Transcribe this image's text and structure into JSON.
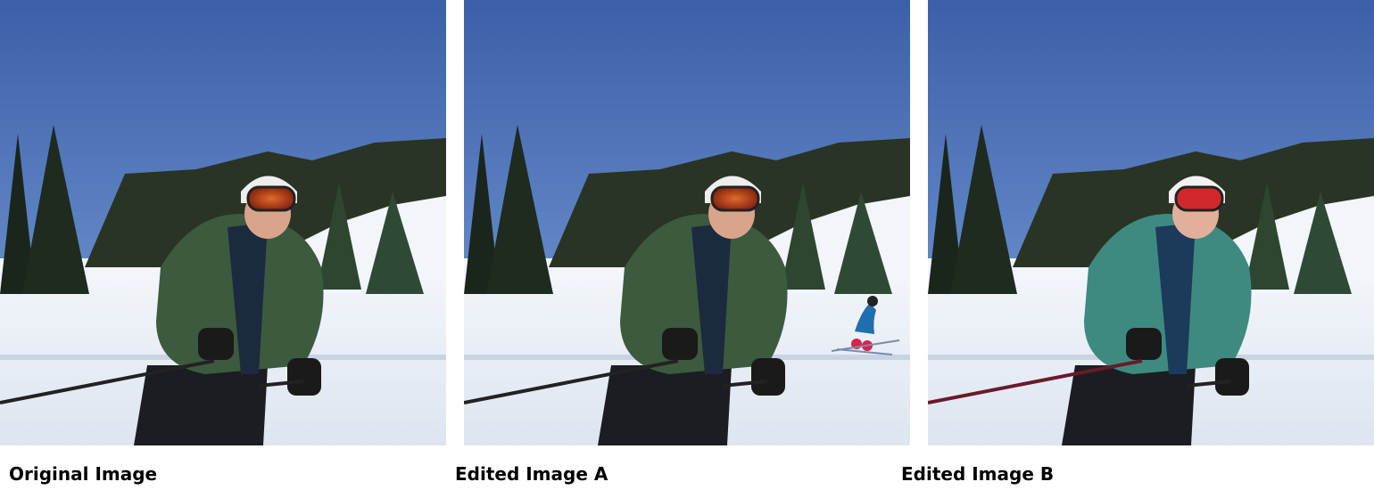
{
  "panels": [
    {
      "caption": "Original Image",
      "jacket_color": "#3c5a3e",
      "edit": "none"
    },
    {
      "caption": "Edited Image A",
      "jacket_color": "#3c5a3e",
      "edit": "added-background-skier"
    },
    {
      "caption": "Edited Image B",
      "jacket_color": "#3e8a80",
      "edit": "recolored-jacket"
    }
  ],
  "colors": {
    "sky_top": "#3d5fa8",
    "sky_bottom": "#6f9bd8",
    "snow": "#eef2f8",
    "trees": "#1f2d20",
    "pants": "#1b1d22",
    "goggle_lens": "#c8401e"
  }
}
